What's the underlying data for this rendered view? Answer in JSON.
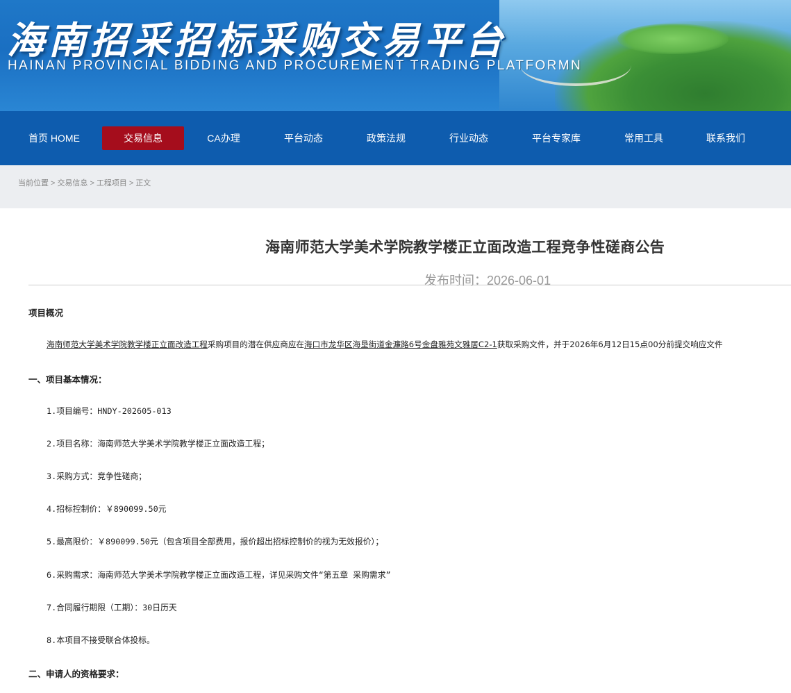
{
  "banner": {
    "title": "海南招采招标采购交易平台",
    "subtitle": "HAINAN PROVINCIAL BIDDING AND PROCUREMENT TRADING PLATFORMN"
  },
  "nav": {
    "items": [
      {
        "label": "首页 HOME",
        "active": false
      },
      {
        "label": "交易信息",
        "active": true
      },
      {
        "label": "CA办理",
        "active": false
      },
      {
        "label": "平台动态",
        "active": false
      },
      {
        "label": "政策法规",
        "active": false
      },
      {
        "label": "行业动态",
        "active": false
      },
      {
        "label": "平台专家库",
        "active": false
      },
      {
        "label": "常用工具",
        "active": false
      },
      {
        "label": "联系我们",
        "active": false
      }
    ],
    "active_color": "#a50d1c",
    "bar_color": "#0e5cae"
  },
  "breadcrumb": {
    "items": [
      "当前位置",
      "交易信息",
      "工程项目",
      "正文"
    ],
    "separator": ">"
  },
  "article": {
    "title": "海南师范大学美术学院教学楼正立面改造工程竞争性磋商公告",
    "date": "发布时间：2026-06-01",
    "overview_heading": "项目概况",
    "overview_link_project": "海南师范大学美术学院教学楼正立面改造工程",
    "overview_text_1": "采购项目的潜在供应商应在",
    "overview_link_address": "海口市龙华区海垦街道金濂路6号金盘雅苑文雅居C2-1",
    "overview_text_2": "获取采购文件，并于2026年6月12日15点00分前提交响应文件",
    "section1_heading": "一、项目基本情况：",
    "section1_items": [
      "1.项目编号：HNDY-202605-013",
      "2.项目名称：海南师范大学美术学院教学楼正立面改造工程；",
      "3.采购方式：竞争性磋商；",
      "4.招标控制价：￥890099.50元",
      "5.最高限价：￥890099.50元（包含项目全部费用，报价超出招标控制价的视为无效报价）；",
      "6.采购需求：海南师范大学美术学院教学楼正立面改造工程，详见采购文件“第五章 采购需求”",
      "7.合同履行期限（工期）：30日历天",
      "8.本项目不接受联合体投标。"
    ],
    "section2_heading": "二、申请人的资格要求："
  }
}
